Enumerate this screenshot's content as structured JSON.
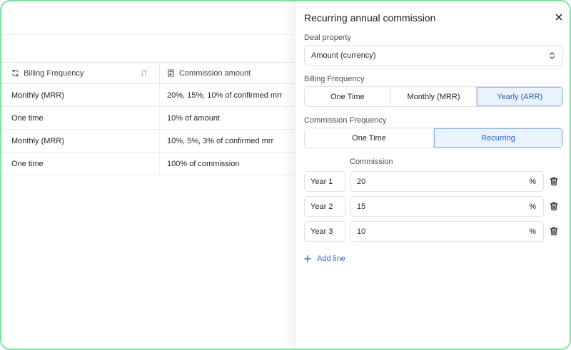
{
  "table": {
    "columns": [
      {
        "label": "Billing Frequency",
        "icon": "refresh-icon"
      },
      {
        "label": "Commission amount",
        "icon": "document-icon"
      }
    ],
    "rows": [
      [
        "Monthly (MRR)",
        "20%, 15%, 10% of confirmed mrr"
      ],
      [
        "One time",
        "10% of amount"
      ],
      [
        "Monthly (MRR)",
        "10%, 5%, 3% of confirmed mrr"
      ],
      [
        "One time",
        "100% of commission"
      ]
    ]
  },
  "panel": {
    "title": "Recurring annual commission",
    "deal_property_label": "Deal property",
    "deal_property_value": "Amount (currency)",
    "billing_frequency_label": "Billing Frequency",
    "billing_options": [
      "One Time",
      "Monthly (MRR)",
      "Yearly (ARR)"
    ],
    "billing_selected": "Yearly (ARR)",
    "commission_frequency_label": "Commission Frequency",
    "commission_frequency_options": [
      "One Time",
      "Recurring"
    ],
    "commission_frequency_selected": "Recurring",
    "commission_label": "Commission",
    "commission_lines": [
      {
        "year": "Year 1",
        "value": "20",
        "unit": "%"
      },
      {
        "year": "Year 2",
        "value": "15",
        "unit": "%"
      },
      {
        "year": "Year 3",
        "value": "10",
        "unit": "%"
      }
    ],
    "add_line_label": "Add line"
  },
  "colors": {
    "frame_border": "#7fe0a6",
    "accent": "#2563c9",
    "active_bg": "#eaf2fd"
  }
}
